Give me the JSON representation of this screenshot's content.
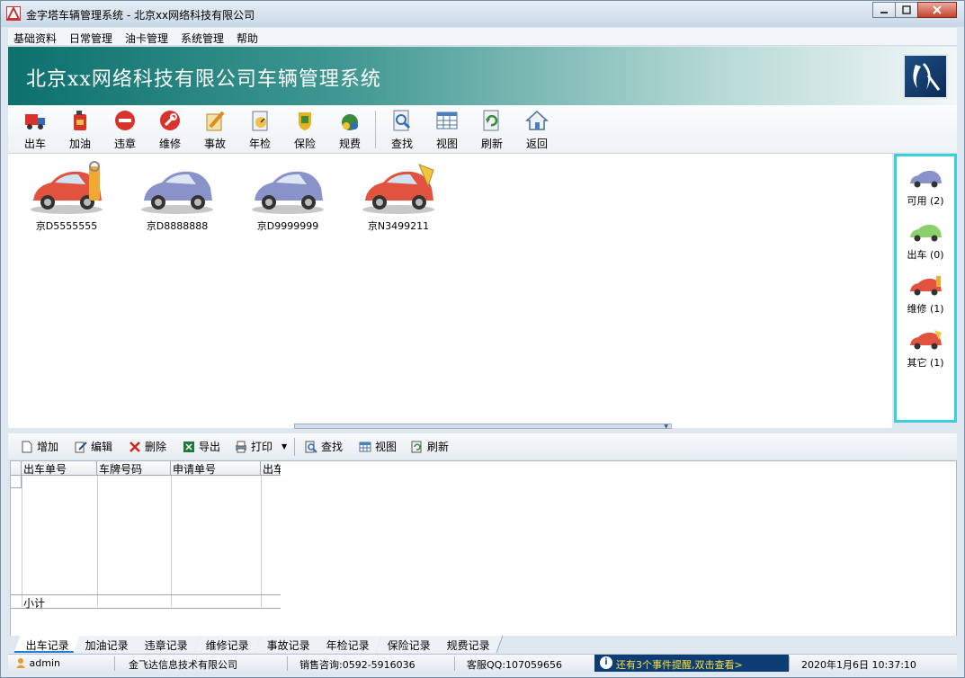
{
  "window": {
    "title": "金字塔车辆管理系统 - 北京xx网络科技有限公司",
    "controls": {
      "minimize": "0",
      "maximize": "1",
      "close": "X"
    }
  },
  "menu": [
    "基础资料",
    "日常管理",
    "油卡管理",
    "系统管理",
    "帮助"
  ],
  "banner": {
    "title": "北京xx网络科技有限公司车辆管理系统"
  },
  "toolbar": [
    "出车",
    "加油",
    "违章",
    "维修",
    "事故",
    "年检",
    "保险",
    "规费",
    "查找",
    "视图",
    "刷新",
    "返回"
  ],
  "cars": [
    {
      "plate": "京D5555555",
      "status": "repair"
    },
    {
      "plate": "京D8888888",
      "status": "available"
    },
    {
      "plate": "京D9999999",
      "status": "available"
    },
    {
      "plate": "京N3499211",
      "status": "other"
    }
  ],
  "status_panel": [
    {
      "label": "可用 (2)",
      "color": "#8a93c9"
    },
    {
      "label": "出车 (0)",
      "color": "#8dcf6a"
    },
    {
      "label": "维修 (1)",
      "color": "#e2533f"
    },
    {
      "label": "其它 (1)",
      "color": "#e2533f"
    }
  ],
  "subtoolbar": [
    "增加",
    "编辑",
    "删除",
    "导出",
    "打印",
    "查找",
    "视图",
    "刷新"
  ],
  "grid": {
    "columns": [
      "出车单号",
      "车牌号码",
      "申请单号",
      "出车"
    ],
    "footer": "小计"
  },
  "tabs": [
    "出车记录",
    "加油记录",
    "违章记录",
    "维修记录",
    "事故记录",
    "年检记录",
    "保险记录",
    "规费记录"
  ],
  "statusbar": {
    "user": "admin",
    "company": "金飞达信息技术有限公司",
    "sales": "销售咨询:0592-5916036",
    "service": "客服QQ:107059656",
    "alert": "还有3个事件提醒,双击查看>",
    "datetime": "2020年1月6日  10:37:10"
  },
  "colors": {
    "accent_cyan": "#38d0dc",
    "banner_teal": "#0c706d",
    "alert_bg": "#0d3d74",
    "alert_text": "#ffe03b"
  }
}
